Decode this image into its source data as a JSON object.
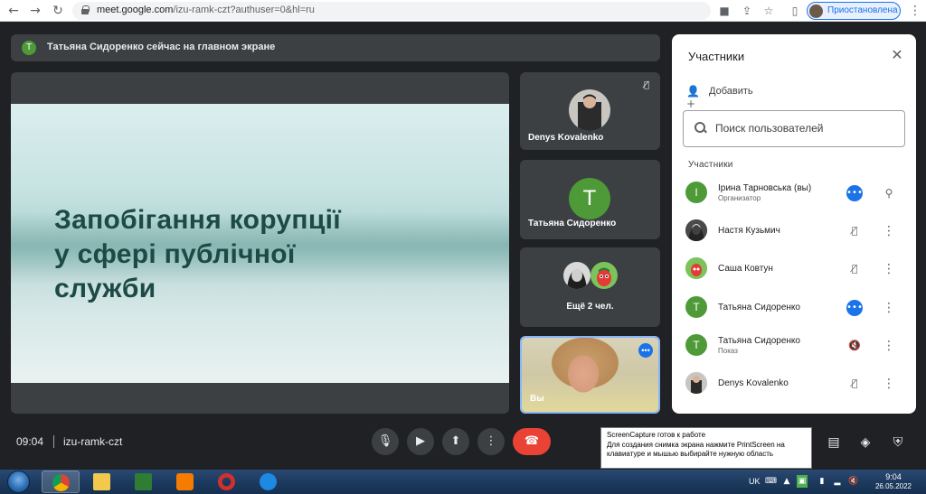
{
  "browser": {
    "url_host": "meet.google.com",
    "url_path": "/izu-ramk-czt?authuser=0&hl=ru",
    "profile_label": "Приостановлена"
  },
  "notice": {
    "avatar_letter": "Т",
    "text": "Татьяна Сидоренко сейчас на главном экране"
  },
  "presentation": {
    "title_line1": "Запобігання корупції",
    "title_line2": "у сфері публічної",
    "title_line3": "служби"
  },
  "tiles": [
    {
      "name": "Denys Kovalenko",
      "muted": true
    },
    {
      "name": "Татьяна Сидоренко",
      "avatar_letter": "Т"
    },
    {
      "name": "Ещё 2 чел."
    },
    {
      "name": "Вы"
    }
  ],
  "panel": {
    "title": "Участники",
    "add_label": "Добавить",
    "search_placeholder": "Поиск пользователей",
    "section_label": "Участники",
    "participants": [
      {
        "name": "Ірина Тарновська (вы)",
        "role": "Организатор",
        "avatar_letter": "І",
        "avatar_color": "#4e9a38",
        "action": "more-dots"
      },
      {
        "name": "Настя Кузьмич",
        "role": "",
        "action": "mic-off"
      },
      {
        "name": "Саша Ковтун",
        "role": "",
        "action": "mic-off"
      },
      {
        "name": "Татьяна Сидоренко",
        "role": "",
        "avatar_letter": "Т",
        "avatar_color": "#4e9a38",
        "action": "more-dots"
      },
      {
        "name": "Татьяна Сидоренко",
        "role": "Показ",
        "avatar_letter": "Т",
        "avatar_color": "#4e9a38",
        "action": "volume-off"
      },
      {
        "name": "Denys Kovalenko",
        "role": "",
        "action": "mic-off"
      }
    ]
  },
  "bottom_bar": {
    "time": "09:04",
    "meeting_code": "izu-ramk-czt"
  },
  "tooltip": {
    "title": "ScreenCapture готов к работе",
    "body": "Для создания снимка экрана нажмите PrintScreen на клавиатуре и мышью выбирайте нужную область"
  },
  "taskbar": {
    "language": "UK",
    "clock_time": "9:04",
    "clock_date": "26.05.2022"
  },
  "colors": {
    "accent": "#1a73e8",
    "end_call": "#ea4335",
    "avatar_green": "#4e9a38",
    "meet_bg": "#202124",
    "tile_bg": "#3c4043"
  }
}
